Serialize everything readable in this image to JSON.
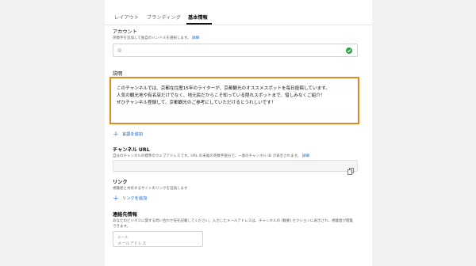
{
  "tabs": [
    {
      "label": "レイアウト"
    },
    {
      "label": "ブランディング"
    },
    {
      "label": "基本情報"
    }
  ],
  "account": {
    "label": "アカウント",
    "help": "英数字を追加して独自のハンドルを選択します。",
    "help_link": "詳細",
    "handle_value": "@"
  },
  "description": {
    "label": "説明",
    "lines": [
      "このチャンネルでは、京都在住歴15年のライターが、京都観光のオススメスポットを毎日投稿しています。",
      "人気の観光地や有名店だけでなく、地元民だからこそ知っている隠れスポットまで、惜しみなくご紹介！",
      "ぜひチャンネル登録して、京都観光のご参考にしていただけるとうれしいです！"
    ],
    "add_language": "言語を追加"
  },
  "channel_url": {
    "label": "チャンネル URL",
    "help": "自分のチャンネルの標準のウェブアドレスです。URL の末尾の英数字部分で、一意のチャンネル ID が表示されます。",
    "help_link": "詳細"
  },
  "links": {
    "label": "リンク",
    "help": "視聴者と共有するサイトのリンクを追加します",
    "add_link": "リンクを追加"
  },
  "contact": {
    "label": "連絡先情報",
    "help_line1": "あなたのビジネスに関する問い合わせ先を記載してください。入力したメールアドレスは、チャンネルの [概要] セクションに表示され、視聴者が閲覧",
    "help_line2": "できます。",
    "email_label": "メール",
    "email_placeholder": "メールアドレス"
  },
  "colors": {
    "highlight": "#e08a1e",
    "link": "#065fd4",
    "verified": "#2ba640"
  }
}
